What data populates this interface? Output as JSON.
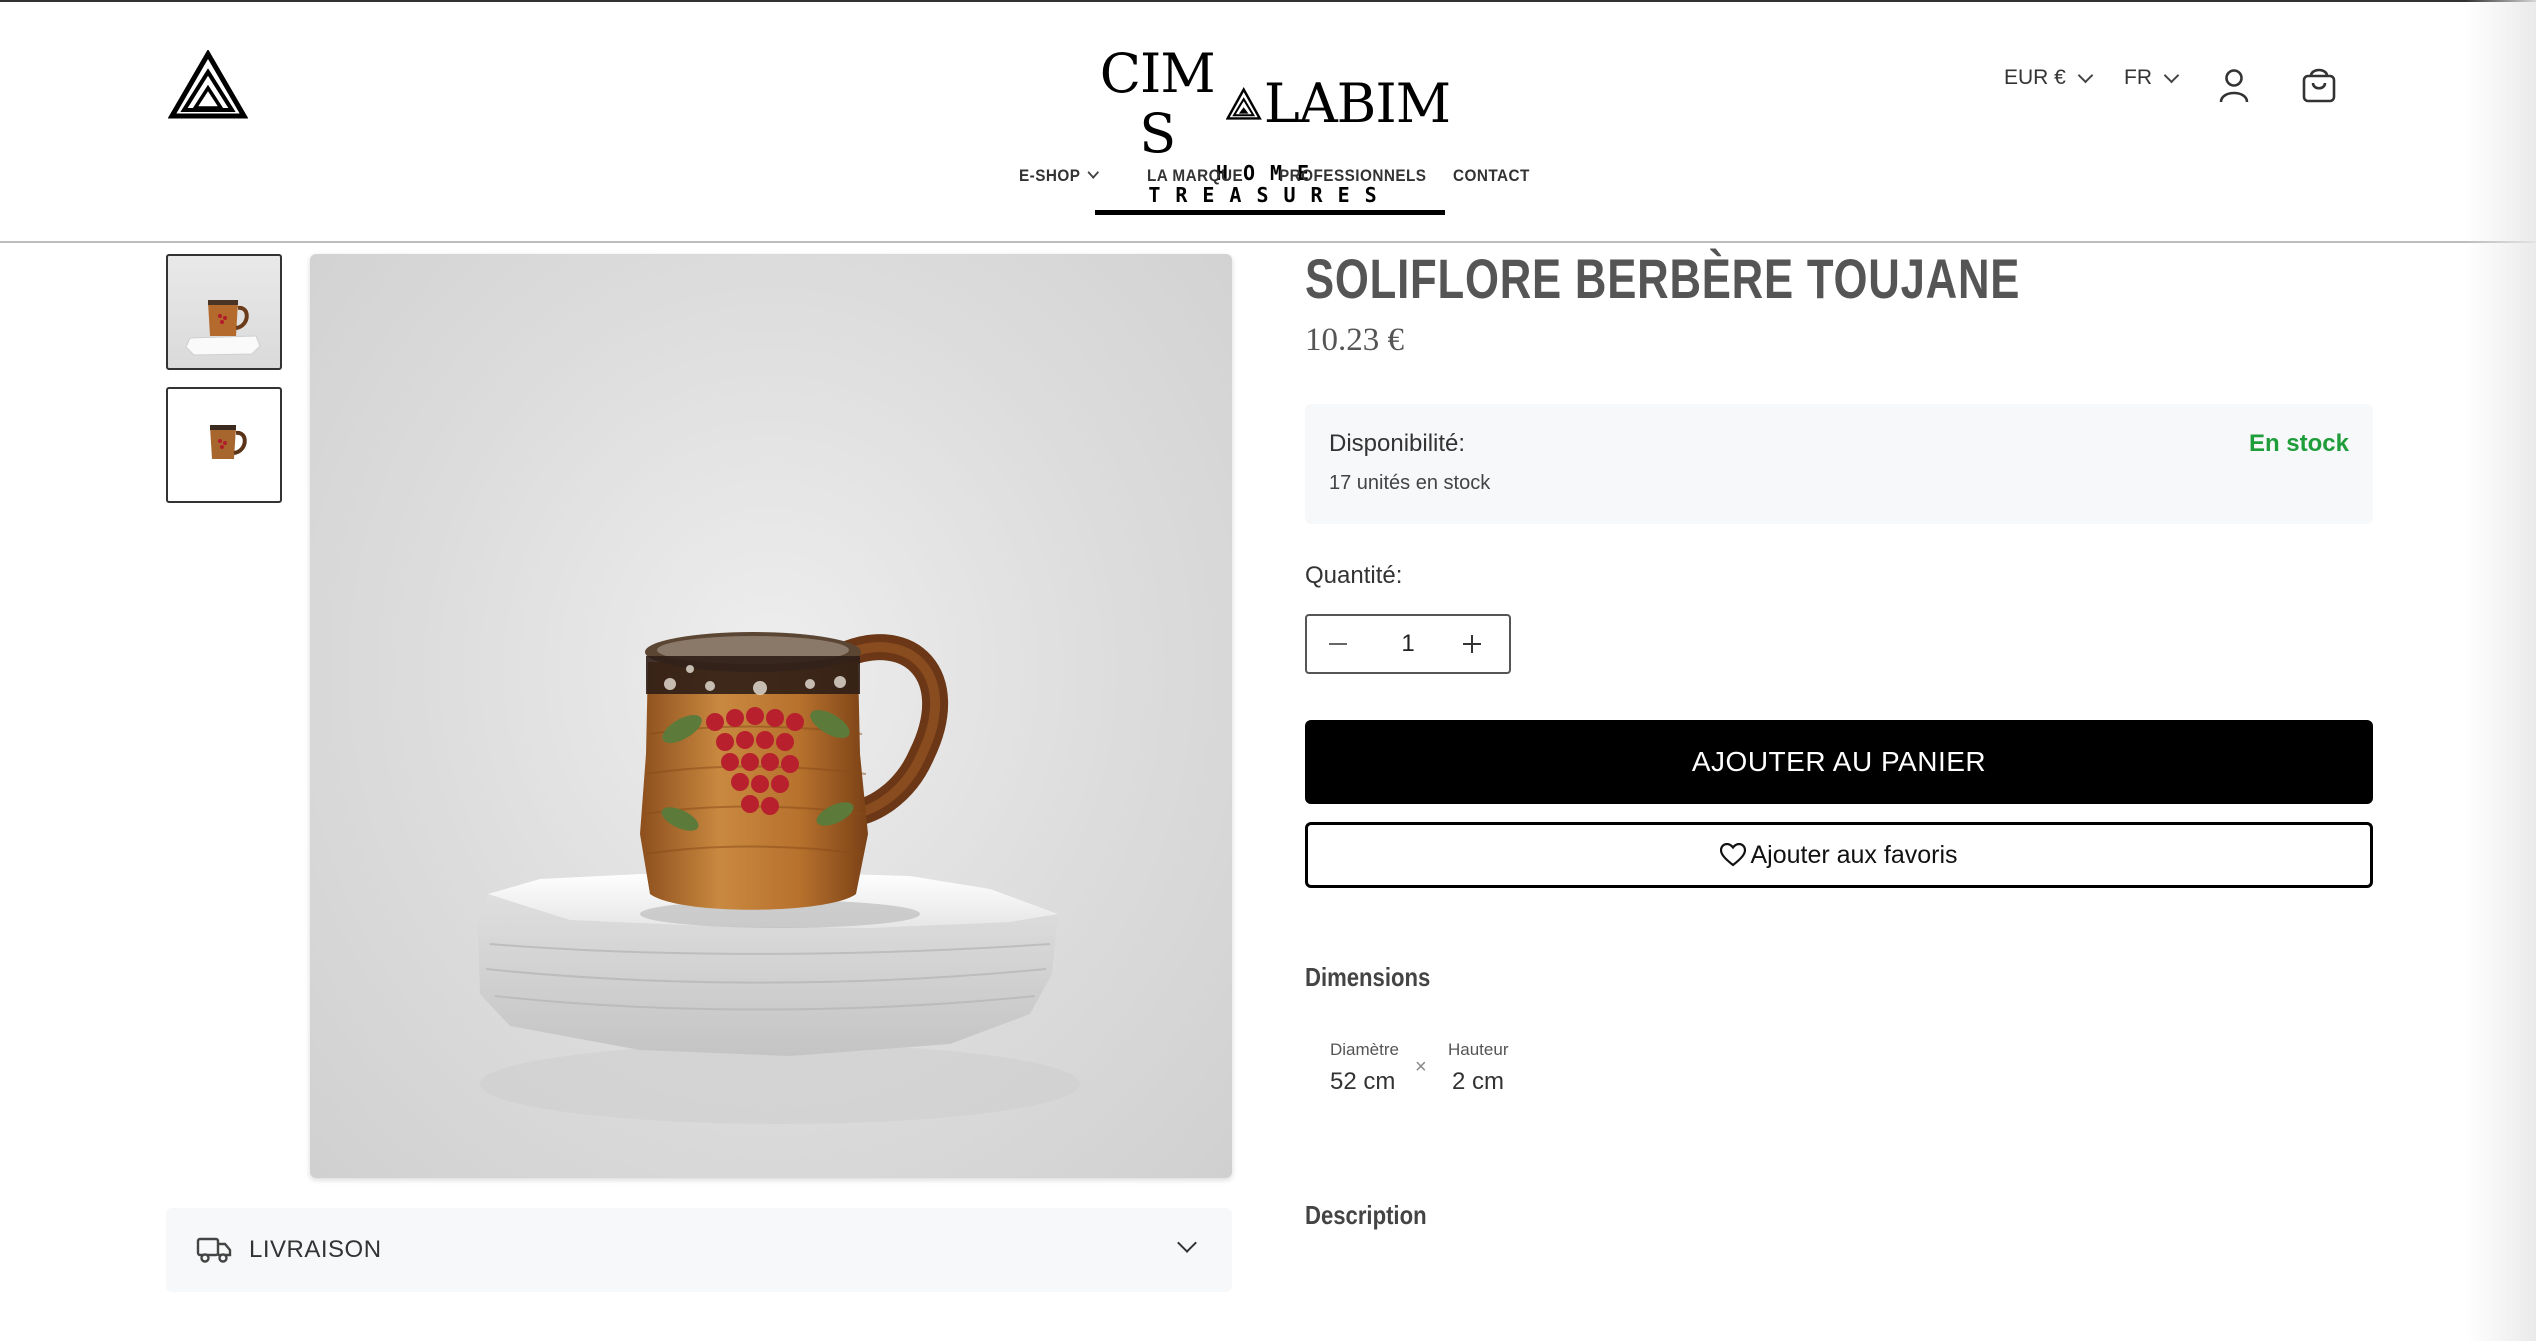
{
  "header": {
    "logo": {
      "main_left": "CIM S",
      "main_right": "LABIM",
      "sub": "HOME TREASURES"
    },
    "currency": "EUR €",
    "language": "FR",
    "icons": {
      "brand": "triangle-logo-icon",
      "account": "user-icon",
      "cart": "shopping-bag-icon"
    }
  },
  "nav": {
    "items": [
      {
        "label": "E-SHOP",
        "has_dropdown": true
      },
      {
        "label": "LA MARQUE",
        "has_dropdown": false
      },
      {
        "label": "PROFESSIONNELS",
        "has_dropdown": false
      },
      {
        "label": "CONTACT",
        "has_dropdown": false
      }
    ]
  },
  "product": {
    "title": "SOLIFLORE BERBÈRE TOUJANE",
    "price": "10.23 €",
    "availability": {
      "label": "Disponibilité:",
      "status": "En stock",
      "count": "17 unités en stock",
      "status_color": "#1f9d3a"
    },
    "quantity": {
      "label": "Quantité:",
      "value": "1"
    },
    "add_to_cart_label": "AJOUTER AU PANIER",
    "favorite_label": "Ajouter aux favoris",
    "dimensions": {
      "heading": "Dimensions",
      "diameter_label": "Diamètre",
      "diameter_value": "52 cm",
      "separator": "×",
      "height_label": "Hauteur",
      "height_value": "2 cm"
    },
    "description_heading": "Description"
  },
  "delivery": {
    "label": "LIVRAISON",
    "icon": "truck-icon"
  }
}
